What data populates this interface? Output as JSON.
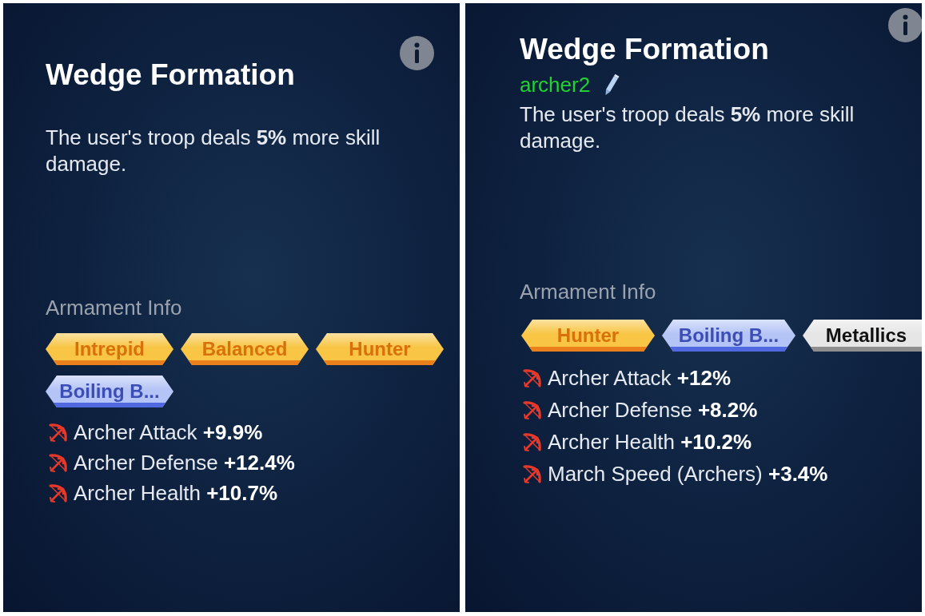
{
  "panels": [
    {
      "title": "Wedge Formation",
      "description": "The user's troop deals **5%** more skill damage.",
      "armament": {
        "heading": "Armament Info",
        "tags": [
          {
            "label": "Intrepid",
            "color": "#f8c544",
            "cut_off": false
          },
          {
            "label": "Balanced",
            "color": "#f8c544",
            "cut_off": false
          },
          {
            "label": "Hunter",
            "color": "#f8c544",
            "cut_off": false
          },
          {
            "label": "Boiling B...",
            "color": "#b4c4f6",
            "cut_off": false
          }
        ],
        "stats": [
          "Archer Attack **+9.9%**",
          "Archer Defense **+12.4%**",
          "Archer Health **+10.7%**"
        ]
      }
    },
    {
      "title": "Wedge Formation",
      "custom_name": "archer2",
      "description": "The user's troop deals **5%** more skill damage.",
      "armament": {
        "heading": "Armament Info",
        "tags": [
          {
            "label": "Hunter",
            "color": "#f8c544",
            "cut_off": false
          },
          {
            "label": "Boiling B...",
            "color": "#b4c4f6",
            "cut_off": false
          },
          {
            "label": "Metallics",
            "color": "#e6e6e6",
            "cut_off": true
          }
        ],
        "stats": [
          "Archer Attack **+12%**",
          "Archer Defense **+8.2%**",
          "Archer Health **+10.2%**",
          "March Speed (Archers) **+3.4%**"
        ]
      }
    }
  ]
}
